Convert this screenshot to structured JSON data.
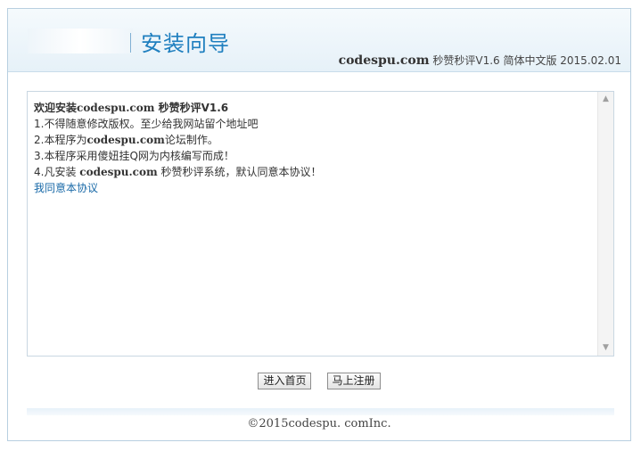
{
  "header": {
    "title": "安装向导",
    "site": "codespu.com",
    "product": "秒赞秒评V1.6 简体中文版 2015.02.01"
  },
  "content": {
    "welcome_prefix": "欢迎安装",
    "welcome_site": "codespu.com",
    "welcome_product": "秒赞秒评V1.6",
    "line1": "1.不得随意修改版权。至少给我网站留个地址吧",
    "line2_prefix": "2.本程序为",
    "line2_site": "codespu.com",
    "line2_suffix": "论坛制作。",
    "line3": "3.本程序采用傻妞挂Q网为内核编写而成！",
    "line4_prefix": "4.凡安装",
    "line4_site": "codespu.com",
    "line4_suffix": "秒赞秒评系统，默认同意本协议！",
    "agree_link": "我同意本协议"
  },
  "scrollbar": {
    "up_icon": "▲",
    "down_icon": "▼"
  },
  "buttons": {
    "home": "进入首页",
    "register": "马上注册"
  },
  "footer": {
    "copyright": "©2015codespu. comInc."
  }
}
